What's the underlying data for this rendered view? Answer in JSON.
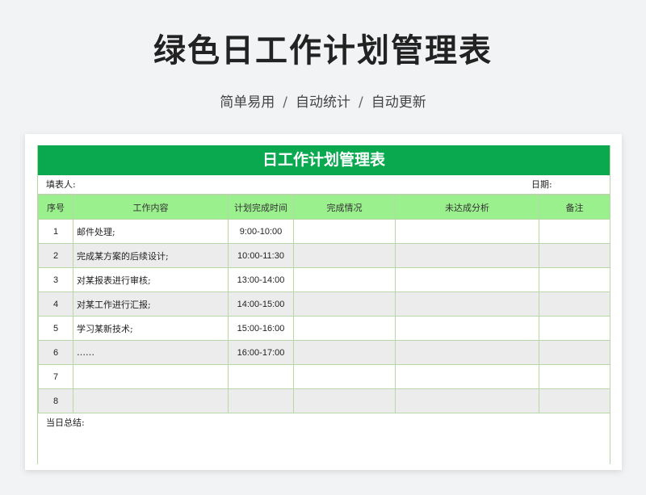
{
  "header": {
    "title": "绿色日工作计划管理表",
    "features": [
      "简单易用",
      "自动统计",
      "自动更新"
    ],
    "separator": "/"
  },
  "sheet": {
    "title": "日工作计划管理表",
    "filler_label": "填表人:",
    "date_label": "日期:",
    "columns": [
      "序号",
      "工作内容",
      "计划完成时间",
      "完成情况",
      "未达成分析",
      "备注"
    ],
    "rows": [
      {
        "no": "1",
        "content": "邮件处理;",
        "time": "9:00-10:00",
        "status": "",
        "analysis": "",
        "remark": ""
      },
      {
        "no": "2",
        "content": "完成某方案的后续设计;",
        "time": "10:00-11:30",
        "status": "",
        "analysis": "",
        "remark": ""
      },
      {
        "no": "3",
        "content": "对某报表进行审核;",
        "time": "13:00-14:00",
        "status": "",
        "analysis": "",
        "remark": ""
      },
      {
        "no": "4",
        "content": "对某工作进行汇报;",
        "time": "14:00-15:00",
        "status": "",
        "analysis": "",
        "remark": ""
      },
      {
        "no": "5",
        "content": "学习某新技术;",
        "time": "15:00-16:00",
        "status": "",
        "analysis": "",
        "remark": ""
      },
      {
        "no": "6",
        "content": "……",
        "time": "16:00-17:00",
        "status": "",
        "analysis": "",
        "remark": ""
      },
      {
        "no": "7",
        "content": "",
        "time": "",
        "status": "",
        "analysis": "",
        "remark": ""
      },
      {
        "no": "8",
        "content": "",
        "time": "",
        "status": "",
        "analysis": "",
        "remark": ""
      }
    ],
    "summary_label": "当日总结:"
  },
  "colors": {
    "title_bar": "#0aa94f",
    "header_row": "#9bf08e",
    "alt_row": "#ececec",
    "grid": "#b7d7a8"
  }
}
